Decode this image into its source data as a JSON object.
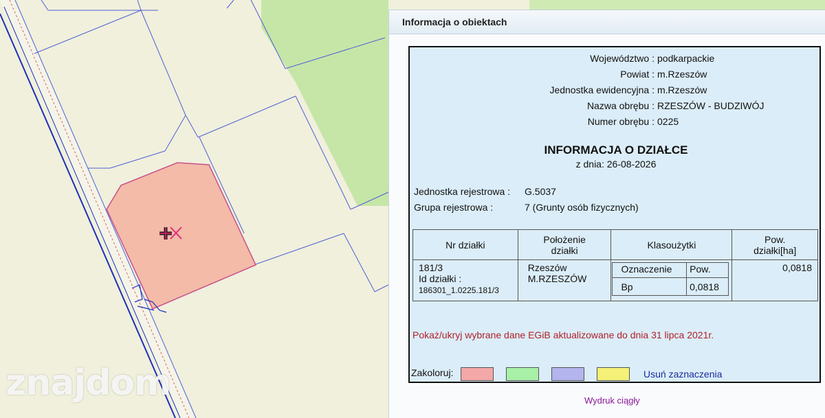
{
  "watermark": "znajdom",
  "map": {
    "parcel_fill": "#f3bba8",
    "parcel_stroke": "#c8508a",
    "boundary_color": "#4f5fd6",
    "road_color": "#1d2fb8",
    "field_light": "#f0f0dc",
    "field_green": "#c6e6a8"
  },
  "panel": {
    "header": "Informacja o obiektach",
    "admin": [
      {
        "label": "Województwo :",
        "value": "podkarpackie"
      },
      {
        "label": "Powiat :",
        "value": "m.Rzeszów"
      },
      {
        "label": "Jednostka ewidencyjna :",
        "value": "m.Rzeszów"
      },
      {
        "label": "Nazwa obrębu :",
        "value": "RZESZÓW - BUDZIWÓJ"
      },
      {
        "label": "Numer obrębu :",
        "value": "0225"
      }
    ],
    "title": "INFORMACJA O DZIAŁCE",
    "date": "z dnia: 26-08-2026",
    "reg_unit_label": "Jednostka rejestrowa :",
    "reg_unit_value": "G.5037",
    "reg_group_label": "Grupa rejestrowa    :",
    "reg_group_value": "7 (Grunty osób fizycznych)",
    "table": {
      "headers": {
        "nr": "Nr działki",
        "loc": "Położenie działki",
        "cls": "Klasoużytki",
        "area": "Pow. działki[ha]"
      },
      "row": {
        "nr": "181/3",
        "id_label": "Id działki :",
        "id_value": "186301_1.0225.181/3",
        "loc_city": "Rzeszów",
        "loc_name": "M.RZESZÓW",
        "cls_h1": "Oznaczenie",
        "cls_h2": "Pow.",
        "cls_v1": "Bp",
        "cls_v2": "0,0818",
        "area": "0,0818"
      }
    },
    "egib_link": "Pokaż/ukryj wybrane dane EGiB aktualizowane do dnia 31 lipca 2021r.",
    "color_label": "Zakoloruj:",
    "colors": [
      "#f4a8a8",
      "#a8f0a8",
      "#b4b4ee",
      "#f4f078"
    ],
    "clear_link": "Usuń zaznaczenia",
    "print_link": "Wydruk ciągły"
  }
}
